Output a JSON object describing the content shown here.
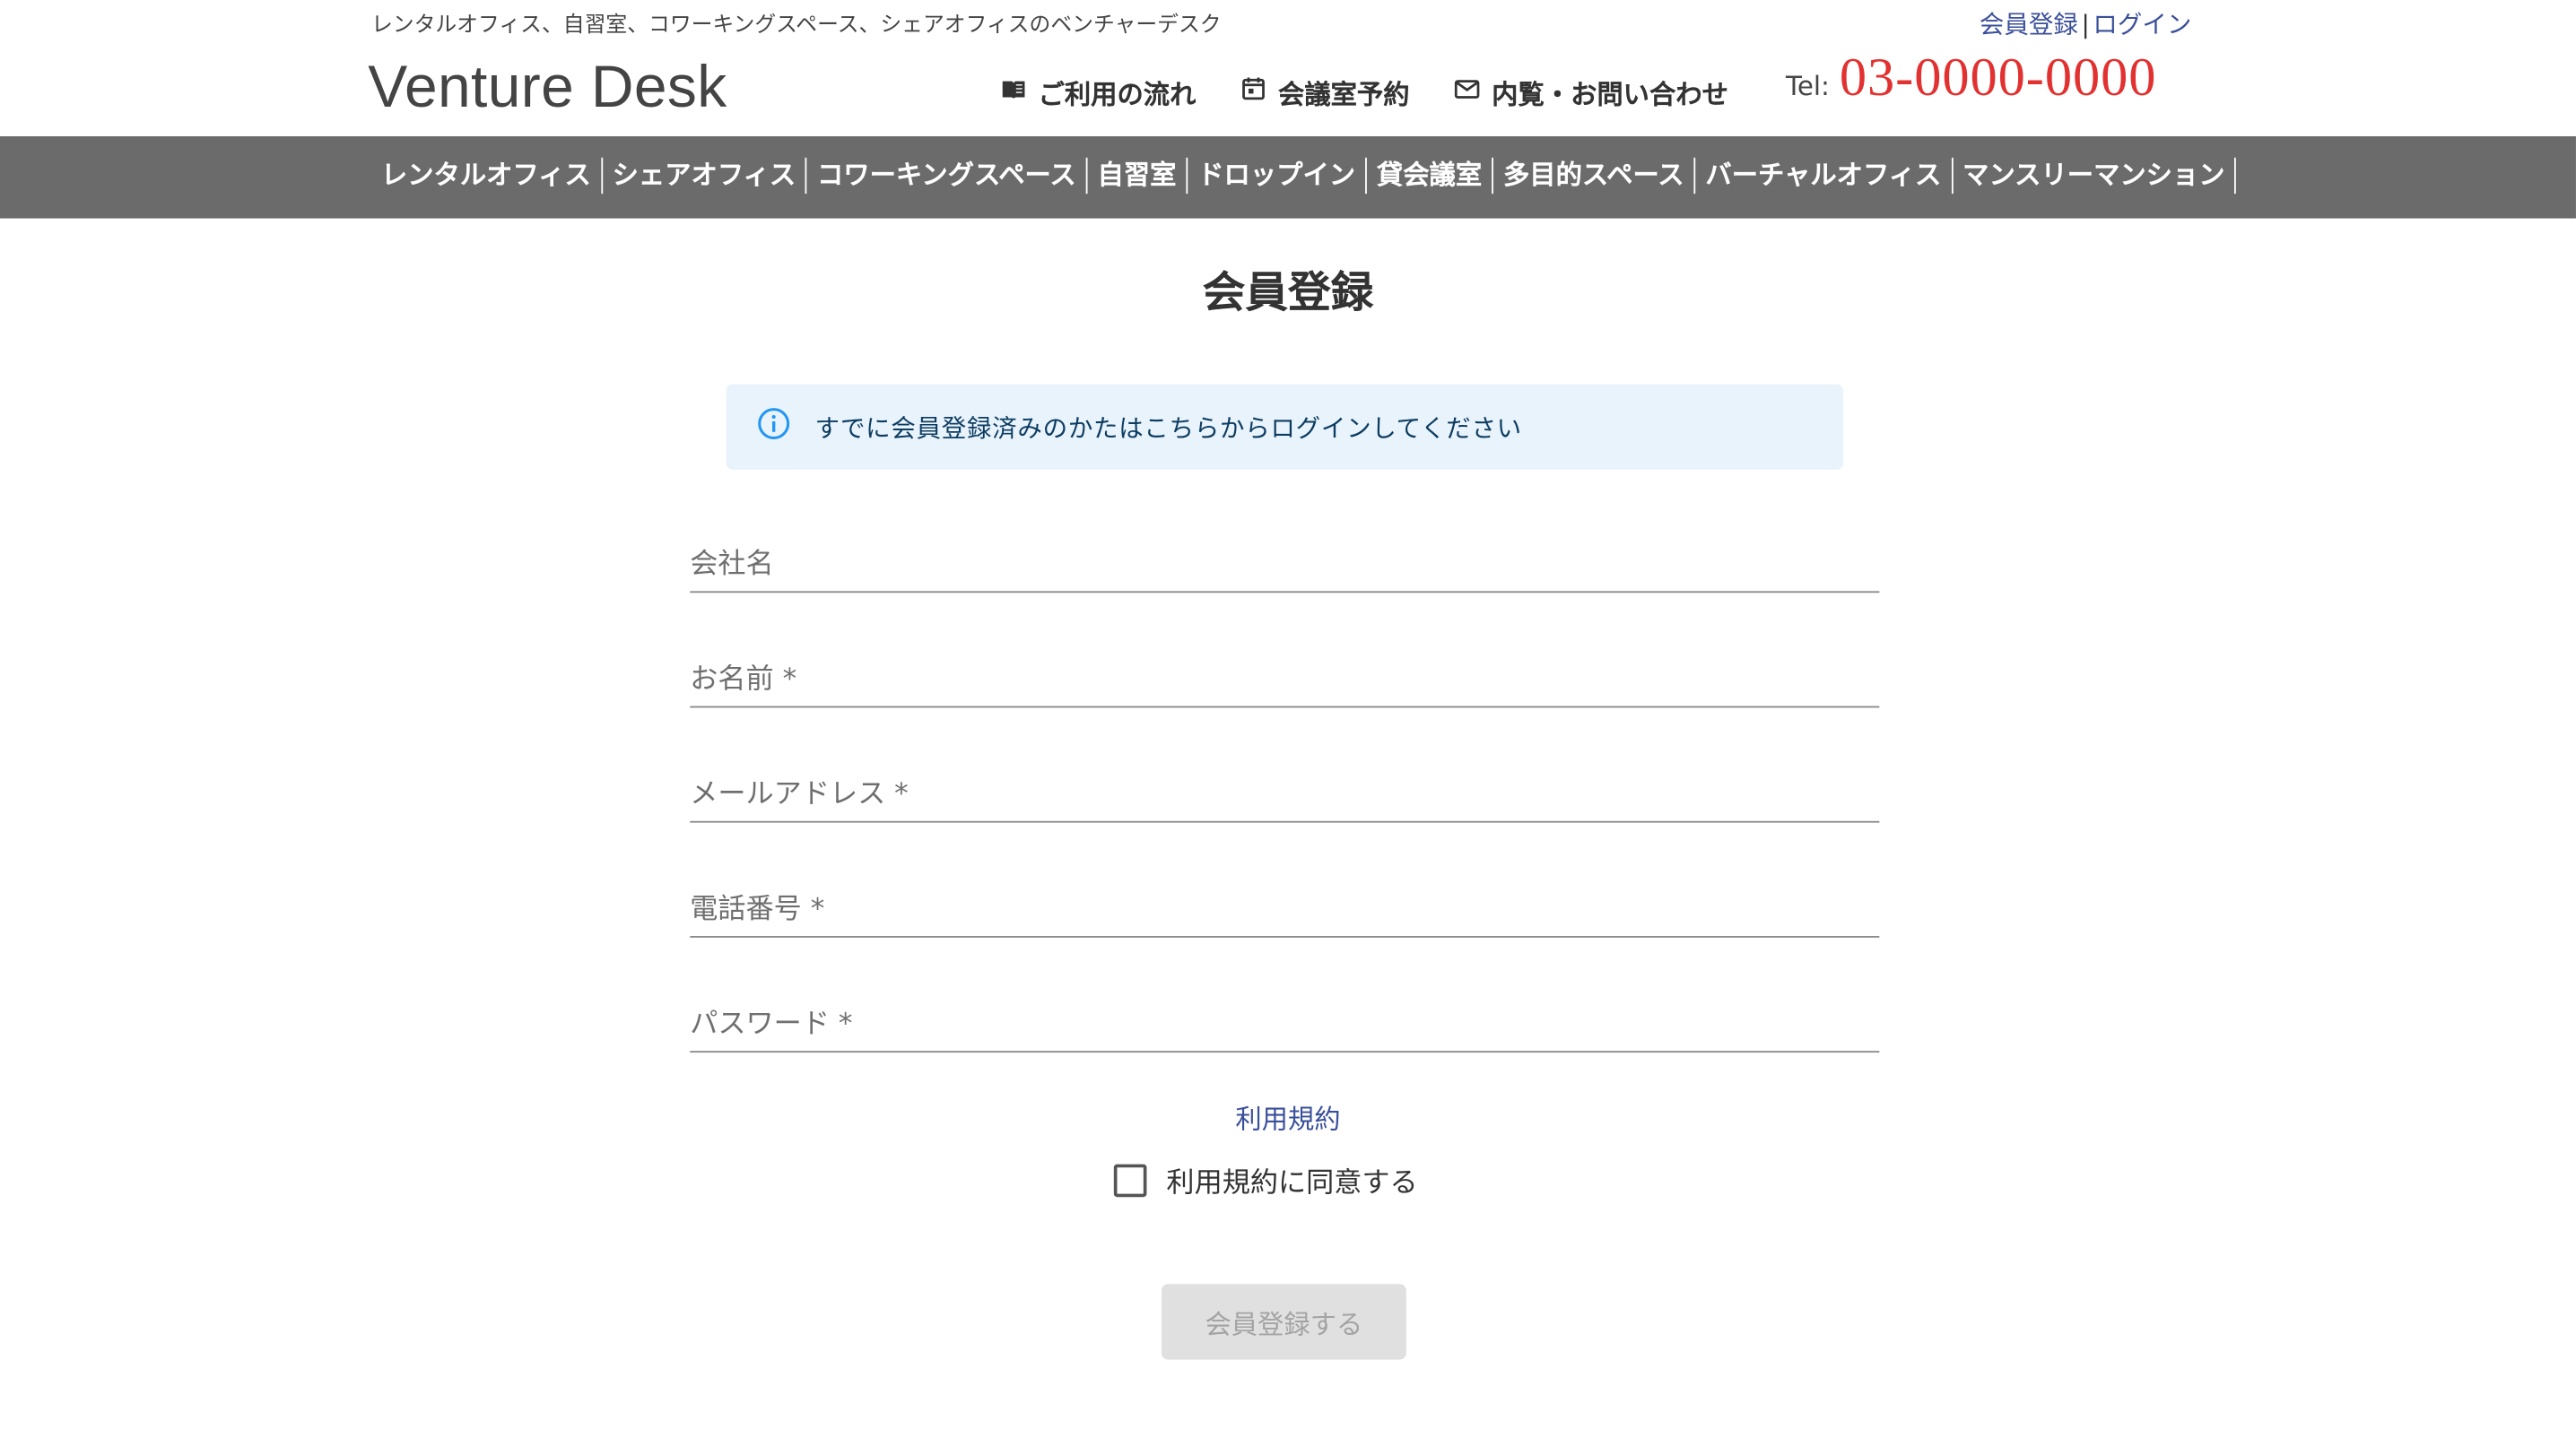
{
  "header": {
    "tagline": "レンタルオフィス、自習室、コワーキングスペース、シェアオフィスのベンチャーデスク",
    "auth": {
      "register": "会員登録",
      "separator": "|",
      "login": "ログイン"
    },
    "logo": "Venture Desk",
    "topnav": [
      {
        "label": "ご利用の流れ",
        "icon": "book-icon"
      },
      {
        "label": "会議室予約",
        "icon": "calendar-icon"
      },
      {
        "label": "内覧・お問い合わせ",
        "icon": "mail-icon"
      }
    ],
    "tel_label": "Tel:",
    "tel_number": "03-0000-0000"
  },
  "categories": [
    "レンタルオフィス",
    "シェアオフィス",
    "コワーキングスペース",
    "自習室",
    "ドロップイン",
    "貸会議室",
    "多目的スペース",
    "バーチャルオフィス",
    "マンスリーマンション"
  ],
  "main": {
    "title": "会員登録",
    "info_text": "すでに会員登録済みのかたはこちらからログインしてください",
    "fields": {
      "company": "会社名",
      "name": "お名前 *",
      "email": "メールアドレス *",
      "phone": "電話番号 *",
      "password": "パスワード *"
    },
    "terms_link": "利用規約",
    "agree_label": "利用規約に同意する",
    "submit_label": "会員登録する"
  },
  "colors": {
    "accent_blue": "#3a4f9a",
    "tel_red": "#e23131",
    "category_bar": "#6b6b6b",
    "info_bg": "#e8f3fc"
  }
}
